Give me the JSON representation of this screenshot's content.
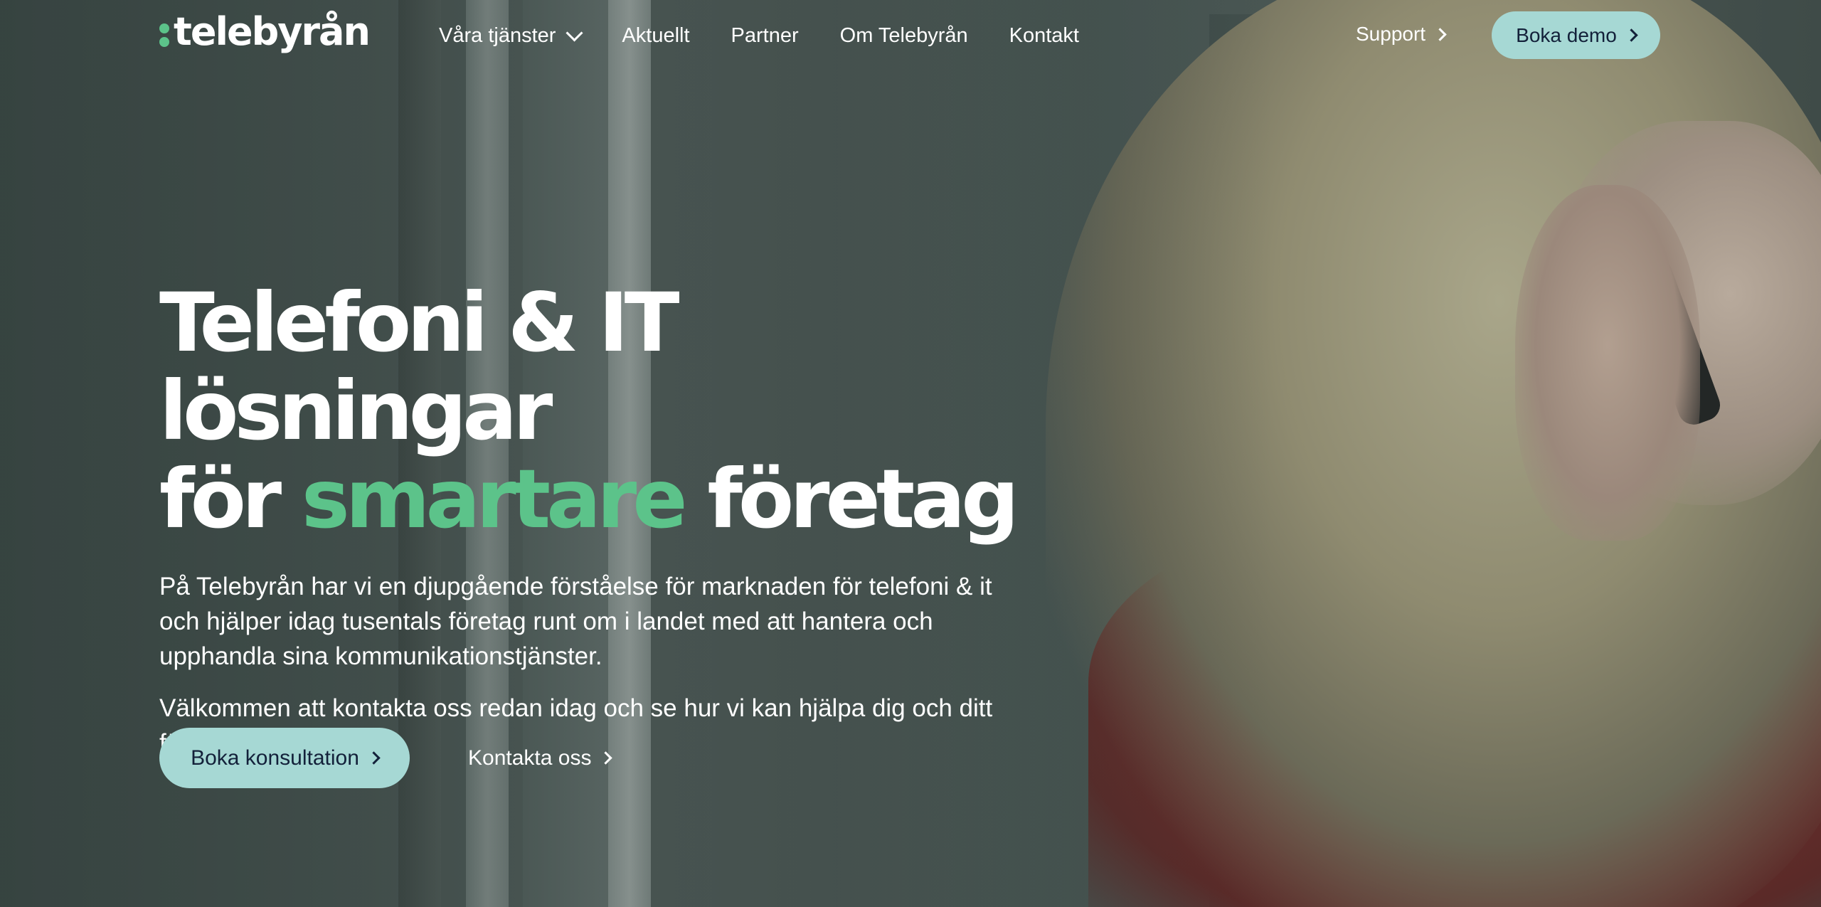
{
  "brand": {
    "name": "telebyrån",
    "accent_color": "#5cc38a",
    "button_color": "#a6d8d4"
  },
  "nav": {
    "items": [
      {
        "label": "Våra tjänster",
        "has_dropdown": true
      },
      {
        "label": "Aktuellt"
      },
      {
        "label": "Partner"
      },
      {
        "label": "Om Telebyrån"
      },
      {
        "label": "Kontakt"
      }
    ],
    "support_label": "Support",
    "demo_label": "Boka demo"
  },
  "hero": {
    "title_line1": "Telefoni & IT lösningar",
    "title_line2_start": "för",
    "title_line2_accent": "smartare",
    "title_line2_end": "företag",
    "paragraph1": "På Telebyrån har vi en djupgående förståelse för marknaden för telefoni & it och hjälper idag tusentals företag runt om i landet med att hantera och upphandla sina kommunikationstjänster.",
    "paragraph2": "Välkommen att kontakta oss redan idag och se hur vi kan hjälpa dig och ditt företag!",
    "primary_cta": "Boka konsultation",
    "secondary_cta": "Kontakta oss"
  }
}
